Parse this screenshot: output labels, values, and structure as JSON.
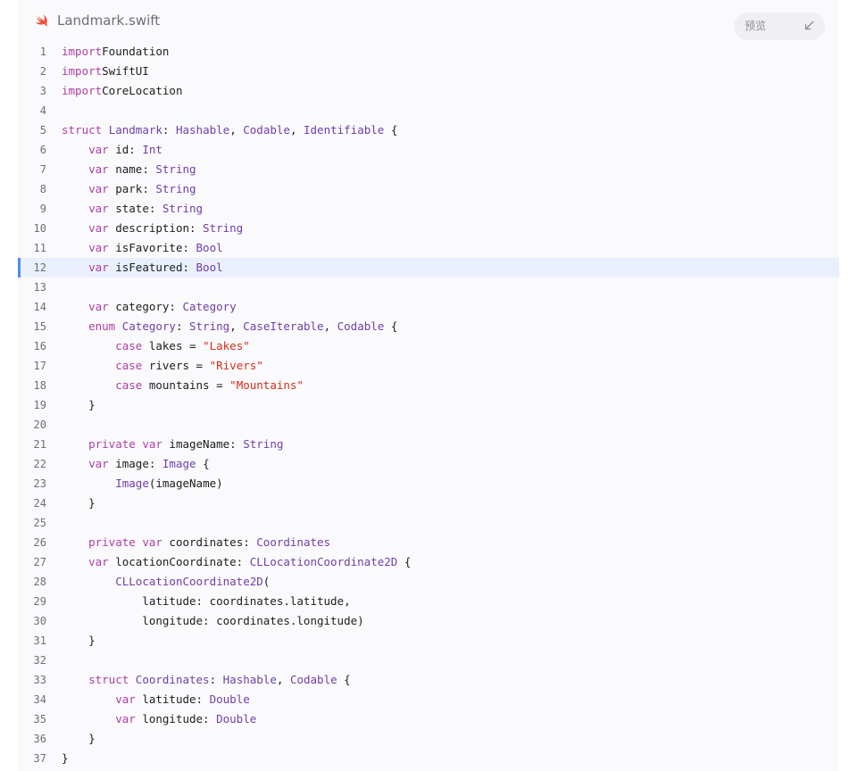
{
  "header": {
    "file_name": "Landmark.swift",
    "preview_label": "预览",
    "logo_icon": "swift-logo-icon",
    "collapse_icon": "collapse-arrow-icon"
  },
  "colors": {
    "keyword": "#ad3da4",
    "type": "#703daa",
    "string": "#d12f1b",
    "text": "#1d1d1f",
    "line_number": "#6e6e73",
    "highlight_bg": "#eaf0fb",
    "highlight_bar": "#4a90e2",
    "swift_orange": "#f05138"
  },
  "editor": {
    "highlighted_line": 12,
    "lines": [
      [
        [
          "kw",
          "import"
        ],
        [
          "",
          "Foundation"
        ]
      ],
      [
        [
          "kw",
          "import"
        ],
        [
          "",
          "SwiftUI"
        ]
      ],
      [
        [
          "kw",
          "import"
        ],
        [
          "",
          "CoreLocation"
        ]
      ],
      [],
      [
        [
          "kw",
          "struct"
        ],
        [
          "",
          " "
        ],
        [
          "ty",
          "Landmark"
        ],
        [
          "",
          ": "
        ],
        [
          "ty",
          "Hashable"
        ],
        [
          "",
          ", "
        ],
        [
          "ty",
          "Codable"
        ],
        [
          "",
          ", "
        ],
        [
          "ty",
          "Identifiable"
        ],
        [
          "",
          " {"
        ]
      ],
      [
        [
          "",
          "    "
        ],
        [
          "kw",
          "var"
        ],
        [
          "",
          " id: "
        ],
        [
          "ty",
          "Int"
        ]
      ],
      [
        [
          "",
          "    "
        ],
        [
          "kw",
          "var"
        ],
        [
          "",
          " name: "
        ],
        [
          "ty",
          "String"
        ]
      ],
      [
        [
          "",
          "    "
        ],
        [
          "kw",
          "var"
        ],
        [
          "",
          " park: "
        ],
        [
          "ty",
          "String"
        ]
      ],
      [
        [
          "",
          "    "
        ],
        [
          "kw",
          "var"
        ],
        [
          "",
          " state: "
        ],
        [
          "ty",
          "String"
        ]
      ],
      [
        [
          "",
          "    "
        ],
        [
          "kw",
          "var"
        ],
        [
          "",
          " description: "
        ],
        [
          "ty",
          "String"
        ]
      ],
      [
        [
          "",
          "    "
        ],
        [
          "kw",
          "var"
        ],
        [
          "",
          " isFavorite: "
        ],
        [
          "ty",
          "Bool"
        ]
      ],
      [
        [
          "",
          "    "
        ],
        [
          "kw",
          "var"
        ],
        [
          "",
          " isFeatured: "
        ],
        [
          "ty",
          "Bool"
        ]
      ],
      [],
      [
        [
          "",
          "    "
        ],
        [
          "kw",
          "var"
        ],
        [
          "",
          " category: "
        ],
        [
          "ty",
          "Category"
        ]
      ],
      [
        [
          "",
          "    "
        ],
        [
          "kw",
          "enum"
        ],
        [
          "",
          " "
        ],
        [
          "ty",
          "Category"
        ],
        [
          "",
          ": "
        ],
        [
          "ty",
          "String"
        ],
        [
          "",
          ", "
        ],
        [
          "ty",
          "CaseIterable"
        ],
        [
          "",
          ", "
        ],
        [
          "ty",
          "Codable"
        ],
        [
          "",
          " {"
        ]
      ],
      [
        [
          "",
          "        "
        ],
        [
          "kw",
          "case"
        ],
        [
          "",
          " lakes = "
        ],
        [
          "st",
          "\"Lakes\""
        ]
      ],
      [
        [
          "",
          "        "
        ],
        [
          "kw",
          "case"
        ],
        [
          "",
          " rivers = "
        ],
        [
          "st",
          "\"Rivers\""
        ]
      ],
      [
        [
          "",
          "        "
        ],
        [
          "kw",
          "case"
        ],
        [
          "",
          " mountains = "
        ],
        [
          "st",
          "\"Mountains\""
        ]
      ],
      [
        [
          "",
          "    }"
        ]
      ],
      [],
      [
        [
          "",
          "    "
        ],
        [
          "kw",
          "private"
        ],
        [
          "",
          " "
        ],
        [
          "kw",
          "var"
        ],
        [
          "",
          " imageName: "
        ],
        [
          "ty",
          "String"
        ]
      ],
      [
        [
          "",
          "    "
        ],
        [
          "kw",
          "var"
        ],
        [
          "",
          " image: "
        ],
        [
          "ty",
          "Image"
        ],
        [
          "",
          " {"
        ]
      ],
      [
        [
          "",
          "        "
        ],
        [
          "ty",
          "Image"
        ],
        [
          "",
          "(imageName)"
        ]
      ],
      [
        [
          "",
          "    }"
        ]
      ],
      [],
      [
        [
          "",
          "    "
        ],
        [
          "kw",
          "private"
        ],
        [
          "",
          " "
        ],
        [
          "kw",
          "var"
        ],
        [
          "",
          " coordinates: "
        ],
        [
          "ty",
          "Coordinates"
        ]
      ],
      [
        [
          "",
          "    "
        ],
        [
          "kw",
          "var"
        ],
        [
          "",
          " locationCoordinate: "
        ],
        [
          "ty",
          "CLLocationCoordinate2D"
        ],
        [
          "",
          " {"
        ]
      ],
      [
        [
          "",
          "        "
        ],
        [
          "ty",
          "CLLocationCoordinate2D"
        ],
        [
          "",
          "("
        ]
      ],
      [
        [
          "",
          "            latitude: coordinates.latitude,"
        ]
      ],
      [
        [
          "",
          "            longitude: coordinates.longitude)"
        ]
      ],
      [
        [
          "",
          "    }"
        ]
      ],
      [],
      [
        [
          "",
          "    "
        ],
        [
          "kw",
          "struct"
        ],
        [
          "",
          " "
        ],
        [
          "ty",
          "Coordinates"
        ],
        [
          "",
          ": "
        ],
        [
          "ty",
          "Hashable"
        ],
        [
          "",
          ", "
        ],
        [
          "ty",
          "Codable"
        ],
        [
          "",
          " {"
        ]
      ],
      [
        [
          "",
          "        "
        ],
        [
          "kw",
          "var"
        ],
        [
          "",
          " latitude: "
        ],
        [
          "ty",
          "Double"
        ]
      ],
      [
        [
          "",
          "        "
        ],
        [
          "kw",
          "var"
        ],
        [
          "",
          " longitude: "
        ],
        [
          "ty",
          "Double"
        ]
      ],
      [
        [
          "",
          "    }"
        ]
      ],
      [
        [
          "",
          "}"
        ]
      ]
    ]
  }
}
